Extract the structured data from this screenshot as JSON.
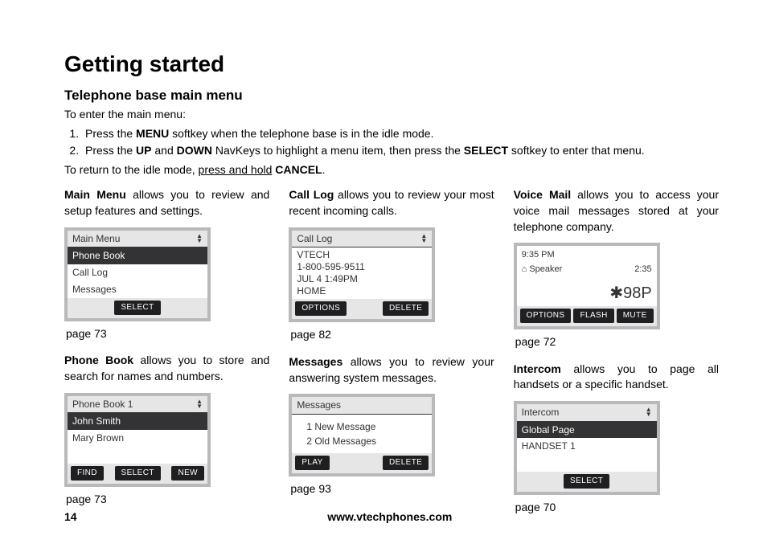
{
  "heading": "Getting started",
  "subheading": "Telephone base main menu",
  "intro": "To enter the main menu:",
  "steps": {
    "s1a": "Press the ",
    "s1b": "MENU",
    "s1c": " softkey when the telephone base is in the idle mode.",
    "s2a": "Press the ",
    "s2b": "UP",
    "s2c": " and ",
    "s2d": "DOWN",
    "s2e": " NavKeys to highlight a menu item, then press the ",
    "s2f": "SELECT",
    "s2g": " softkey to enter that menu."
  },
  "return_a": "To return to the idle mode, ",
  "return_b": "press and hold",
  "return_c": " ",
  "return_d": "CANCEL",
  "return_e": ".",
  "col1": {
    "desc1a": "Main Menu",
    "desc1b": " allows you to review and setup features and settings.",
    "screen1": {
      "title": "Main Menu",
      "items": [
        "Phone Book",
        "Call Log",
        "Messages"
      ],
      "softkeys": [
        "SELECT"
      ]
    },
    "page1": "page 73",
    "desc2a": "Phone Book",
    "desc2b": " allows you to store and search for names and numbers.",
    "screen2": {
      "title": "Phone Book     1",
      "items": [
        "John Smith",
        "Mary Brown"
      ],
      "softkeys": [
        "FIND",
        "SELECT",
        "NEW"
      ]
    },
    "page2": "page 73"
  },
  "col2": {
    "desc1a": "Call Log",
    "desc1b": " allows you to review your most recent incoming calls.",
    "screen1": {
      "title": "Call Log",
      "lines": [
        "VTECH",
        "1-800-595-9511",
        "JUL 4   1:49PM",
        "HOME"
      ],
      "softkeys": [
        "OPTIONS",
        "DELETE"
      ]
    },
    "page1": "page 82",
    "desc2a": "Messages",
    "desc2b": " allows you to review your answering system messages.",
    "screen2": {
      "title": "Messages",
      "lines": [
        "1 New Message",
        "2 Old Messages"
      ],
      "softkeys": [
        "PLAY",
        "DELETE"
      ]
    },
    "page2": "page 93"
  },
  "col3": {
    "desc1a": "Voice Mail",
    "desc1b": " allows you to access your voice mail messages stored at your telephone company.",
    "screen1": {
      "time": "9:35 PM",
      "speaker": "Speaker",
      "duration": "2:35",
      "code": "✱98P",
      "softkeys": [
        "OPTIONS",
        "FLASH",
        "MUTE"
      ]
    },
    "page1": "page 72",
    "desc2a": "Intercom",
    "desc2b": " allows you to page all handsets or a specific handset.",
    "screen2": {
      "title": "Intercom",
      "items": [
        "Global Page",
        "HANDSET 1"
      ],
      "softkeys": [
        "SELECT"
      ]
    },
    "page2": "page 70"
  },
  "footer": {
    "page": "14",
    "url": "www.vtechphones.com"
  }
}
